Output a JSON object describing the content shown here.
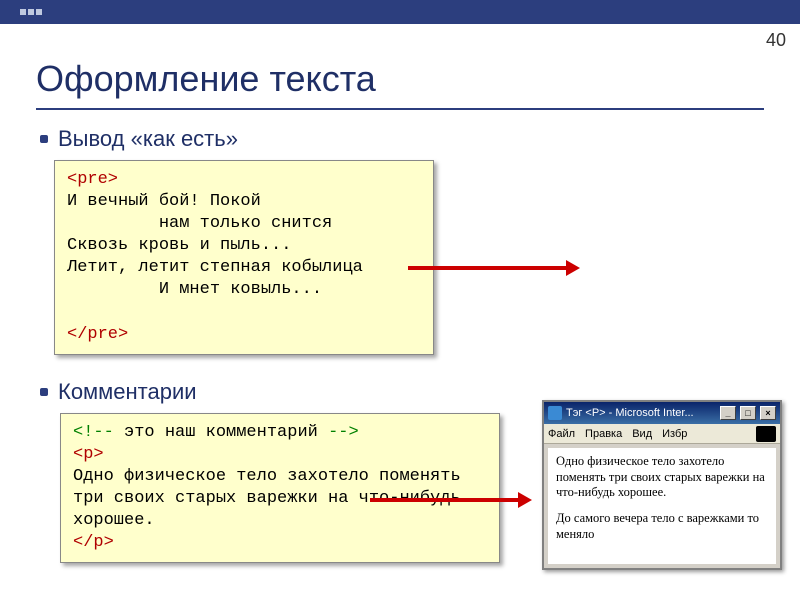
{
  "page_number": "40",
  "title": "Оформление текста",
  "bullets": {
    "as_is": "Вывод «как есть»",
    "comments": "Комментарии"
  },
  "code1": {
    "open": "<pre>",
    "body": "И вечный бой! Покой\n         нам только снится\nСквозь кровь и пыль...\nЛетит, летит степная кобылица\n         И мнет ковыль...\n",
    "close": "</pre>"
  },
  "code2": {
    "comment_open": "<!--",
    "comment_text": " это наш комментарий ",
    "comment_close": "-->",
    "p_open": "<p>",
    "body": "Одно физическое тело захотело поменять три своих старых варежки на что-нибудь хорошее.",
    "p_close": "</p>"
  },
  "browser": {
    "title": "Тэг <P> - Microsoft Inter...",
    "menu": {
      "file": "Файл",
      "edit": "Правка",
      "view": "Вид",
      "fav": "Избр"
    },
    "winbtns": {
      "min": "_",
      "max": "□",
      "close": "×"
    },
    "para1": "Одно физическое тело захотело поменять три своих старых варежки на что-нибудь хорошее.",
    "para2": "До самого вечера тело с варежками то меняло"
  }
}
